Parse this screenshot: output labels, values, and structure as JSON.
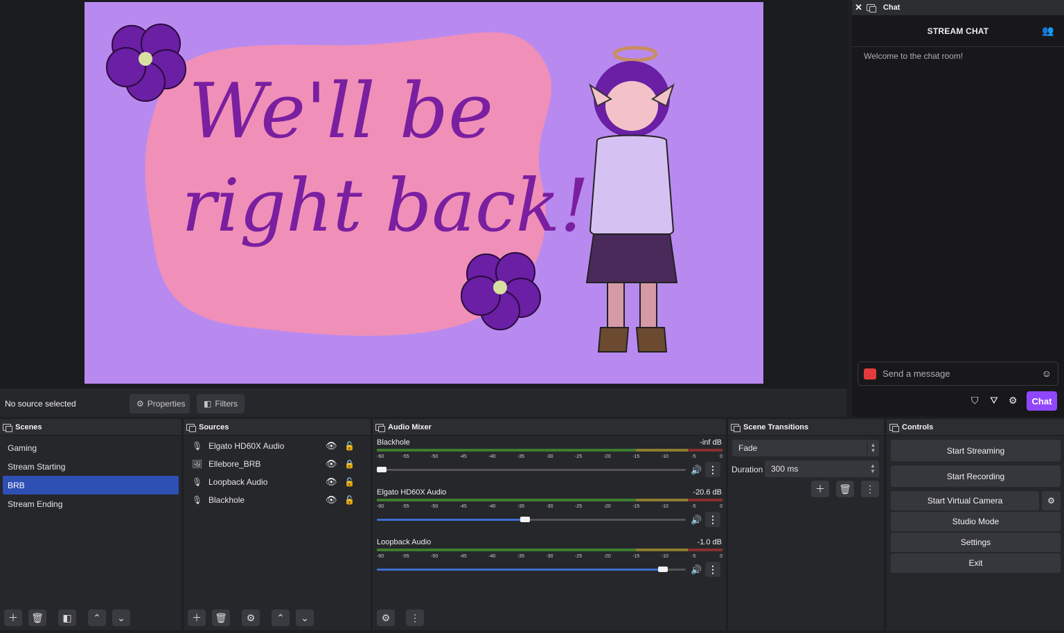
{
  "preview": {
    "scene_text_line1": "We'll be",
    "scene_text_line2": "right back!"
  },
  "source_bar": {
    "status": "No source selected",
    "properties_label": "Properties",
    "filters_label": "Filters"
  },
  "scenes": {
    "title": "Scenes",
    "items": [
      {
        "label": "Gaming",
        "active": false
      },
      {
        "label": "Stream Starting",
        "active": false
      },
      {
        "label": "BRB",
        "active": true
      },
      {
        "label": "Stream Ending",
        "active": false
      }
    ]
  },
  "sources": {
    "title": "Sources",
    "items": [
      {
        "label": "Elgato HD60X Audio",
        "icon": "microphone-icon",
        "visible": true,
        "locked": false
      },
      {
        "label": "Ellebore_BRB",
        "icon": "image-icon",
        "visible": true,
        "locked": true
      },
      {
        "label": "Loopback Audio",
        "icon": "microphone-icon",
        "visible": true,
        "locked": false
      },
      {
        "label": "Blackhole",
        "icon": "microphone-icon",
        "visible": true,
        "locked": false
      }
    ]
  },
  "mixer": {
    "title": "Audio Mixer",
    "ticks": [
      "-60",
      "-55",
      "-50",
      "-45",
      "-40",
      "-35",
      "-30",
      "-25",
      "-20",
      "-15",
      "-10",
      "-5",
      "0"
    ],
    "channels": [
      {
        "name": "Blackhole",
        "db": "-inf dB",
        "volume": 0.0
      },
      {
        "name": "Elgato HD60X Audio",
        "db": "-20.6 dB",
        "volume": 0.48
      },
      {
        "name": "Loopback Audio",
        "db": "-1.0 dB",
        "volume": 0.94
      }
    ]
  },
  "transitions": {
    "title": "Scene Transitions",
    "selected": "Fade",
    "duration_label": "Duration",
    "duration_value": "300 ms"
  },
  "controls": {
    "title": "Controls",
    "start_streaming": "Start Streaming",
    "start_recording": "Start Recording",
    "start_virtual_camera": "Start Virtual Camera",
    "studio_mode": "Studio Mode",
    "settings": "Settings",
    "exit": "Exit"
  },
  "chat": {
    "dock_title": "Chat",
    "header": "STREAM CHAT",
    "welcome": "Welcome to the chat room!",
    "input_placeholder": "Send a message",
    "send_label": "Chat"
  },
  "colors": {
    "accent": "#2e4fb3",
    "twitch_purple": "#9147ff",
    "preview_bg": "#b88af0",
    "blob_pink": "#f090b8",
    "text_purple": "#7a1fa0"
  }
}
